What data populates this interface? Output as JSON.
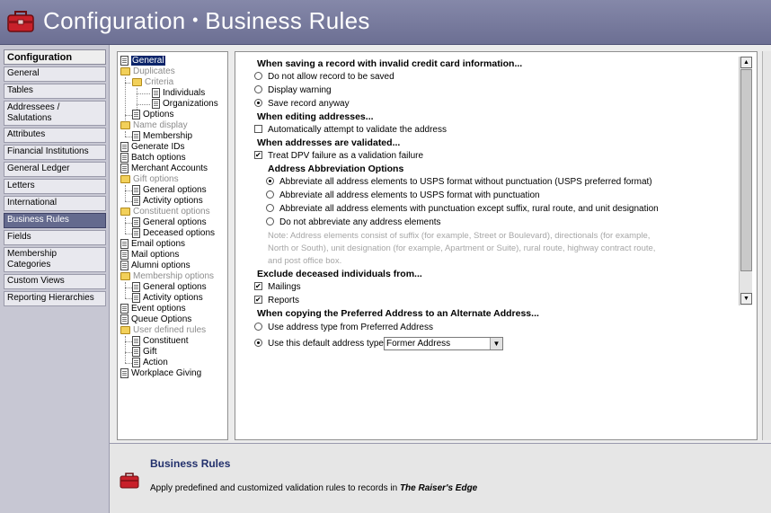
{
  "header": {
    "title_prefix": "Configuration",
    "separator": "•",
    "title_section": "Business Rules"
  },
  "nav": {
    "heading": "Configuration",
    "items": [
      "General",
      "Tables",
      "Addressees / Salutations",
      "Attributes",
      "Financial Institutions",
      "General Ledger",
      "Letters",
      "International",
      "Business Rules",
      "Fields",
      "Membership Categories",
      "Custom Views",
      "Reporting Hierarchies"
    ],
    "selected": "Business Rules"
  },
  "tree": {
    "general": "General",
    "duplicates": "Duplicates",
    "criteria": "Criteria",
    "individuals": "Individuals",
    "organizations": "Organizations",
    "options": "Options",
    "name_display": "Name display",
    "membership": "Membership",
    "generate_ids": "Generate IDs",
    "batch_options": "Batch options",
    "merchant_accounts": "Merchant Accounts",
    "gift_options": "Gift options",
    "gift_general": "General options",
    "gift_activity": "Activity options",
    "constituent_options": "Constituent options",
    "constituent_general": "General options",
    "constituent_deceased": "Deceased options",
    "email_options": "Email options",
    "mail_options": "Mail options",
    "alumni_options": "Alumni options",
    "membership_options": "Membership options",
    "membership_general": "General options",
    "membership_activity": "Activity options",
    "event_options": "Event options",
    "queue_options": "Queue Options",
    "user_defined_rules": "User defined rules",
    "udr_constituent": "Constituent",
    "udr_gift": "Gift",
    "udr_action": "Action",
    "workplace_giving": "Workplace Giving"
  },
  "rules": {
    "h_invalid_cc": "When saving a record with invalid credit card information...",
    "opt_no_save": "Do not allow record to be saved",
    "opt_warning": "Display warning",
    "opt_save_anyway": "Save record anyway",
    "h_editing": "When editing addresses...",
    "chk_validate": "Automatically attempt to validate the address",
    "h_validated": "When addresses are validated...",
    "chk_dpv": "Treat DPV failure as a validation failure",
    "h_abbrev": "Address Abbreviation Options",
    "abbr_1": "Abbreviate all address elements to USPS format without punctuation (USPS preferred format)",
    "abbr_2": "Abbreviate all address elements to USPS format with punctuation",
    "abbr_3": "Abbreviate all address elements with punctuation except suffix, rural route, and unit designation",
    "abbr_4": "Do not abbreviate any address elements",
    "note_1": "Note:  Address elements consist of suffix (for example, Street or Boulevard), directionals (for example,",
    "note_2": "North or South), unit designation (for example, Apartment or Suite), rural route, highway contract route,",
    "note_3": "and post office box.",
    "h_exclude": "Exclude deceased individuals from...",
    "chk_mailings": "Mailings",
    "chk_reports": "Reports",
    "h_copy": "When copying the Preferred Address to an Alternate Address...",
    "opt_use_pref": "Use address type from Preferred Address",
    "opt_use_default": "Use this default address type:",
    "default_type_value": "Former Address"
  },
  "footer": {
    "title": "Business Rules",
    "desc_prefix": "Apply predefined and customized validation rules to records in ",
    "desc_product": "The Raiser's Edge"
  },
  "colors": {
    "header_bg": "#7b7ea0",
    "nav_bg": "#c7c7d3",
    "nav_selected": "#646a8e",
    "tree_selected": "#0a246a",
    "footer_title": "#22306c",
    "icon_red": "#c8202a"
  },
  "icons": {
    "app": "red-toolbox-icon",
    "doc": "document-icon",
    "folder": "folder-icon"
  }
}
